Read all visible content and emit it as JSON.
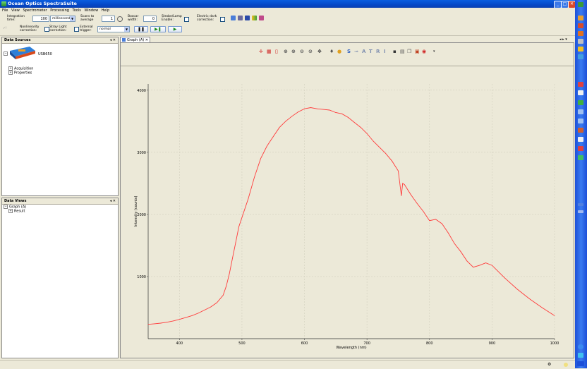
{
  "window": {
    "title": "Ocean Optics SpectraSuite",
    "controls": [
      "_",
      "□",
      "✕"
    ]
  },
  "menu": [
    "File",
    "View",
    "Spectrometer",
    "Processing",
    "Tools",
    "Window",
    "Help"
  ],
  "toolbar": {
    "integration_label_1": "Integration",
    "integration_label_2": "time:",
    "integration_value": "100",
    "integration_unit": "milliseconds",
    "scans_label_1": "Scans to",
    "scans_label_2": "average",
    "scans_value": "1",
    "boxcar_label_1": "Boxcar",
    "boxcar_label_2": "width:",
    "boxcar_value": "0",
    "strobe_label_1": "Strobe/Lamp",
    "strobe_label_2": "Enable:",
    "electric_label_1": "Electric dark",
    "electric_label_2": "correction:",
    "nonlinearity_label_1": "Nonlinearity",
    "nonlinearity_label_2": "correction:",
    "straylight_label_1": "Stray Light",
    "straylight_label_2": "correction:",
    "external_label_1": "External",
    "external_label_2": "trigger:",
    "trigger_value": "normal",
    "pause_label": "❚❚",
    "step_label": "▶❚",
    "play_label": "▶"
  },
  "data_sources": {
    "title": "Data Sources",
    "device": "USB650",
    "items": [
      "Acquisition",
      "Properties"
    ]
  },
  "data_views": {
    "title": "Data Views",
    "root": "Graph (A)",
    "child": "Result"
  },
  "graph": {
    "tab_label": "Graph (A)",
    "tab_close": "✕"
  },
  "colors": {
    "curve": "#ff3b3b",
    "titlebar": "#0a5ee0",
    "background": "#ece9d8"
  },
  "chart_data": {
    "type": "line",
    "title": "",
    "xlabel": "Wavelength (nm)",
    "ylabel": "Intensity (counts)",
    "xlim": [
      350,
      1000
    ],
    "ylim": [
      0,
      4100
    ],
    "x_ticks": [
      400,
      500,
      600,
      700,
      800,
      900,
      1000
    ],
    "y_ticks": [
      1000,
      2000,
      3000,
      4000
    ],
    "grid": true,
    "series": [
      {
        "color": "#ff3b3b",
        "x": [
          350,
          360,
          370,
          380,
          390,
          400,
          410,
          420,
          430,
          440,
          450,
          460,
          470,
          475,
          480,
          485,
          490,
          495,
          500,
          510,
          520,
          530,
          540,
          550,
          560,
          570,
          580,
          590,
          600,
          610,
          620,
          630,
          640,
          650,
          660,
          670,
          680,
          690,
          700,
          710,
          720,
          730,
          740,
          750,
          755,
          757,
          760,
          770,
          780,
          790,
          800,
          810,
          820,
          830,
          840,
          850,
          860,
          870,
          880,
          890,
          900,
          920,
          940,
          960,
          980,
          1000
        ],
        "y": [
          230,
          240,
          250,
          265,
          285,
          310,
          340,
          370,
          410,
          460,
          510,
          580,
          700,
          850,
          1050,
          1300,
          1550,
          1800,
          1950,
          2250,
          2600,
          2900,
          3100,
          3250,
          3400,
          3500,
          3580,
          3650,
          3700,
          3720,
          3700,
          3690,
          3680,
          3640,
          3620,
          3560,
          3480,
          3400,
          3300,
          3180,
          3080,
          2980,
          2860,
          2700,
          2300,
          2500,
          2480,
          2320,
          2180,
          2050,
          1900,
          1920,
          1850,
          1700,
          1530,
          1400,
          1250,
          1150,
          1180,
          1220,
          1180,
          980,
          800,
          640,
          500,
          370
        ]
      }
    ]
  },
  "status": {
    "tray": "⚙"
  }
}
